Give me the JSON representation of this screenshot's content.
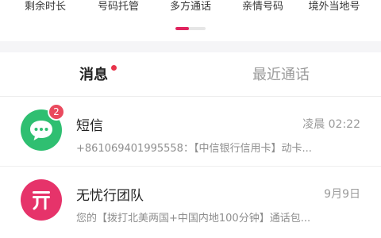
{
  "features": {
    "items": [
      {
        "label": "剩余时长"
      },
      {
        "label": "号码托管"
      },
      {
        "label": "多方通话"
      },
      {
        "label": "亲情号码"
      },
      {
        "label": "境外当地号"
      }
    ],
    "page_indicator": {
      "active_fraction": 0.45,
      "active_color": "#e0245e"
    }
  },
  "tabs": {
    "messages_label": "消息",
    "messages_has_dot": true,
    "calls_label": "最近通话"
  },
  "conversations": [
    {
      "icon": "chat-bubble-icon",
      "badge": "2",
      "title": "短信",
      "time": "凌晨 02:22",
      "preview": "+861069401995558：【中信银行信用卡】动卡...",
      "avatar_color": "#2fbf71"
    },
    {
      "icon": "wuyouxing-logo-icon",
      "title": "无忧行团队",
      "time": "9月9日",
      "preview": "您的【拨打北美两国+中国内地100分钟】通话包...",
      "avatar_color": "#e6336a"
    }
  ],
  "colors": {
    "accent": "#e0245e",
    "badge": "#ea4a5e",
    "sms_green": "#2fbf71"
  }
}
